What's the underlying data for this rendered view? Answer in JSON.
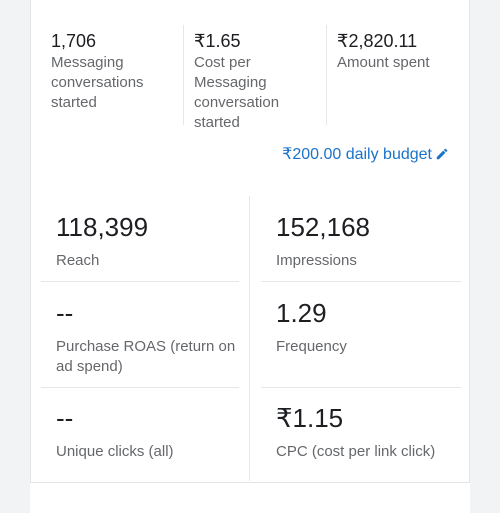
{
  "summary": [
    {
      "value": "1,706",
      "label": "Messaging conversations started"
    },
    {
      "value": "₹1.65",
      "label": "Cost per Messaging conversation started"
    },
    {
      "value": "₹2,820.11",
      "label": "Amount spent"
    }
  ],
  "budget": {
    "label": "₹200.00 daily budget",
    "icon": "pencil-icon"
  },
  "metrics": [
    {
      "value": "118,399",
      "label": "Reach"
    },
    {
      "value": "152,168",
      "label": "Impressions"
    },
    {
      "value": "--",
      "label": "Purchase ROAS (return on ad spend)"
    },
    {
      "value": "1.29",
      "label": "Frequency"
    },
    {
      "value": "--",
      "label": "Unique clicks (all)"
    },
    {
      "value": "₹1.15",
      "label": "CPC (cost per link click)"
    }
  ],
  "colors": {
    "link": "#1a73c9",
    "value": "#1c1e21",
    "label": "#65676b"
  }
}
